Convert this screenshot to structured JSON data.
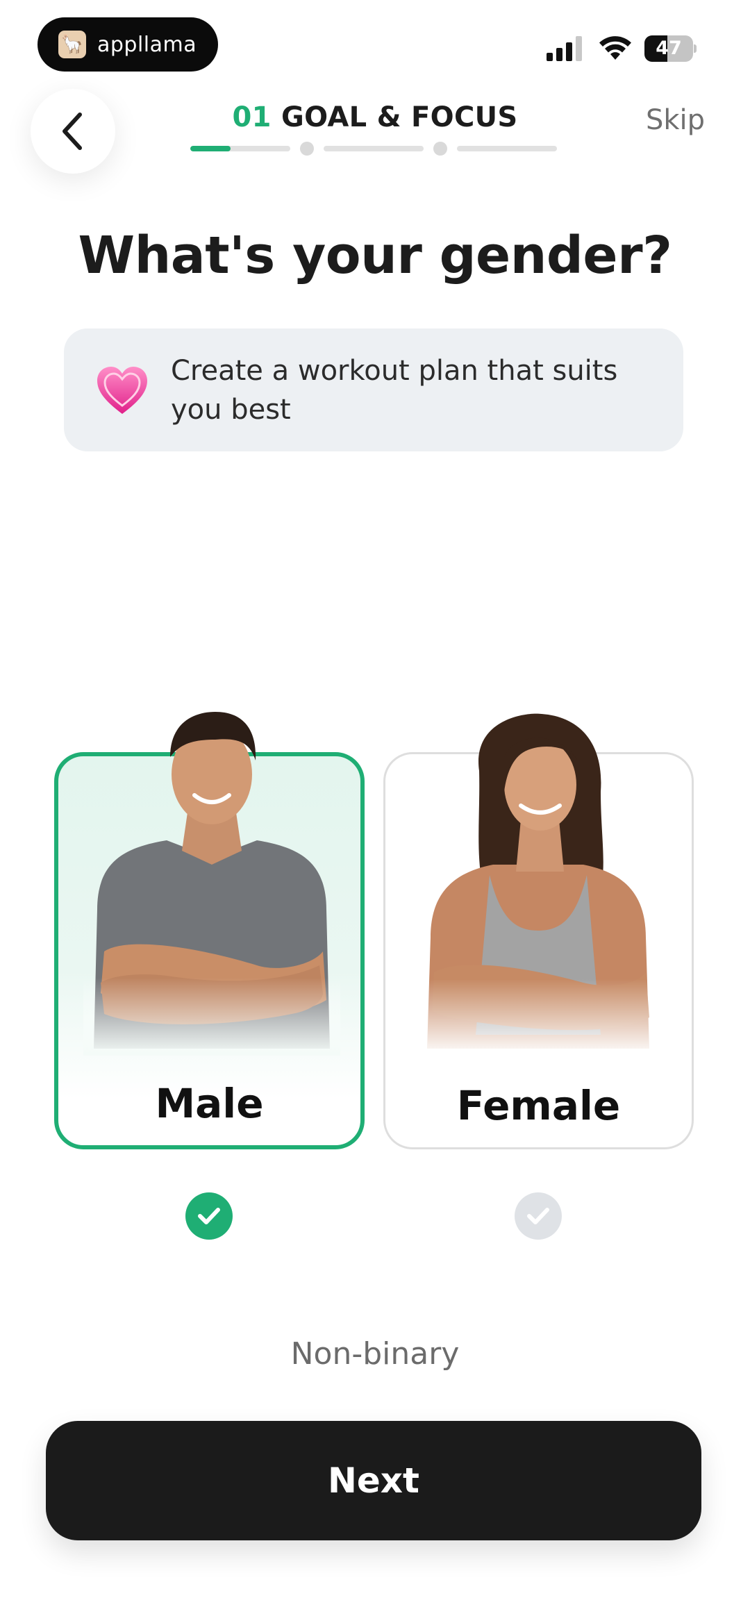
{
  "status_bar": {
    "app_badge_text": "appllama",
    "battery_level": "47",
    "battery_fraction": 0.47,
    "signal_icon": "cellular-signal-icon",
    "wifi_icon": "wifi-icon"
  },
  "header": {
    "back_icon": "chevron-left-icon",
    "step_number": "01",
    "step_title": "GOAL & FOCUS",
    "skip_label": "Skip",
    "progress": {
      "segments": 3,
      "current_segment_fill": 0.4
    }
  },
  "main": {
    "question": "What's your gender?",
    "info": {
      "icon": "heart-icon",
      "text": "Create a workout plan that suits you best"
    },
    "options": [
      {
        "label": "Male",
        "selected": true
      },
      {
        "label": "Female",
        "selected": false
      }
    ],
    "alternate_option": "Non-binary"
  },
  "footer": {
    "next_label": "Next"
  },
  "colors": {
    "accent": "#1fae74",
    "button_dark": "#1b1b1b",
    "info_card_bg": "#edf0f3"
  }
}
